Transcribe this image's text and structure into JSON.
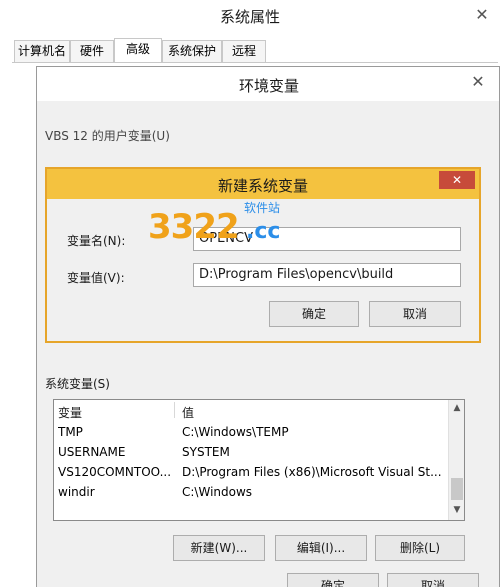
{
  "system_properties": {
    "title": "系统属性",
    "tabs": [
      "计算机名",
      "硬件",
      "高级",
      "系统保护",
      "远程"
    ],
    "active_tab": "高级"
  },
  "env_vars_dialog": {
    "title": "环境变量",
    "user_vars_label_partial": "VBS 12 的用户变量(U)",
    "system_vars_label": "系统变量(S)",
    "columns": [
      "变量",
      "值"
    ],
    "rows": [
      {
        "name": "TMP",
        "value": "C:\\Windows\\TEMP"
      },
      {
        "name": "USERNAME",
        "value": "SYSTEM"
      },
      {
        "name": "VS120COMNTOO...",
        "value": "D:\\Program Files (x86)\\Microsoft Visual St..."
      },
      {
        "name": "windir",
        "value": "C:\\Windows"
      }
    ],
    "buttons": {
      "new": "新建(W)...",
      "edit": "编辑(I)...",
      "delete": "删除(L)"
    },
    "ok": "确定",
    "cancel": "取消"
  },
  "new_var_dialog": {
    "title": "新建系统变量",
    "name_label": "变量名(N):",
    "name_value": "OPENCV",
    "value_label": "变量值(V):",
    "value_value": "D:\\Program Files\\opencv\\build",
    "ok": "确定",
    "cancel": "取消"
  },
  "watermark": {
    "number": "3322",
    "domain": ".cc",
    "tagline": "软件站"
  },
  "icons": {
    "close": "close-icon",
    "scroll_up": "scroll-up-icon",
    "scroll_down": "scroll-down-icon"
  },
  "colors": {
    "accent_titlebar": "#f4c23f",
    "close_red": "#c74b3a",
    "watermark_orange": "#f0a21a",
    "watermark_blue": "#2c8ee8"
  }
}
